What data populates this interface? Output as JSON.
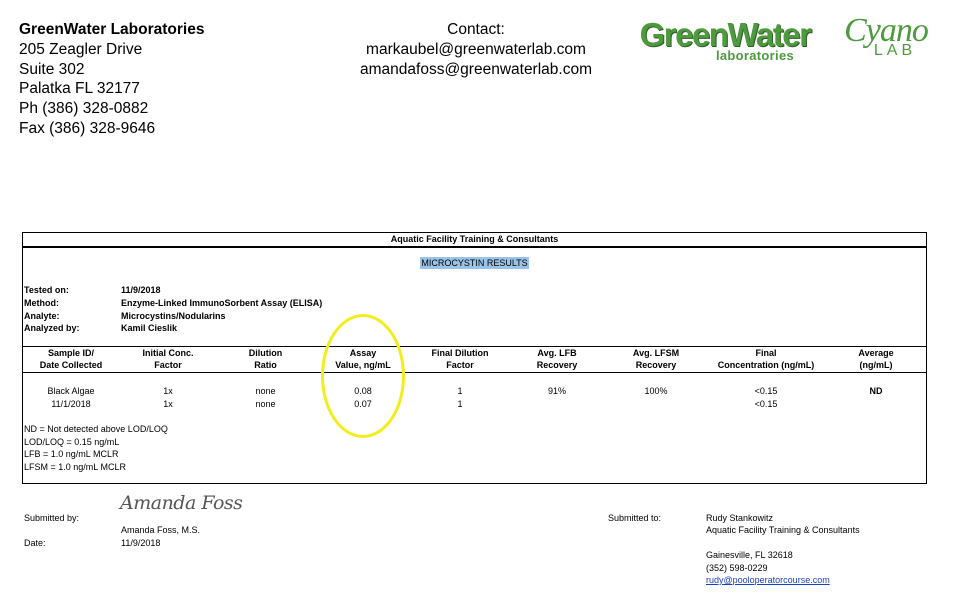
{
  "lab": {
    "name": "GreenWater Laboratories",
    "address_lines": [
      "205 Zeagler Drive",
      "Suite 302",
      "Palatka FL 32177",
      "Ph (386) 328-0882",
      "Fax (386) 328-9646"
    ]
  },
  "contact": {
    "label": "Contact:",
    "emails": [
      "markaubel@greenwaterlab.com",
      "amandafoss@greenwaterlab.com"
    ]
  },
  "logos": {
    "greenwater_main": "GreenWater",
    "greenwater_sub": "laboratories",
    "cyano_main": "Cyano",
    "cyano_sub": "LAB",
    "brand_color": "#4d9a3f"
  },
  "report": {
    "client": "Aquatic Facility Training & Consultants",
    "title": "MICROCYSTIN RESULTS",
    "info": [
      {
        "key": "Tested on:",
        "value": "11/9/2018"
      },
      {
        "key": "Method:",
        "value": "Enzyme-Linked ImmunoSorbent Assay (ELISA)"
      },
      {
        "key": "Analyte:",
        "value": "Microcystins/Nodularins"
      },
      {
        "key": "Analyzed by:",
        "value": "Kamil Cieslik"
      }
    ],
    "columns": [
      [
        "Sample ID/",
        "Date Collected"
      ],
      [
        "Initial Conc.",
        "Factor"
      ],
      [
        "Dilution",
        "Ratio"
      ],
      [
        "Assay",
        "Value, ng/mL"
      ],
      [
        "Final Dilution",
        "Factor"
      ],
      [
        "Avg. LFB",
        "Recovery"
      ],
      [
        "Avg. LFSM",
        "Recovery"
      ],
      [
        "Final",
        "Concentration (ng/mL)"
      ],
      [
        "Average",
        "(ng/mL)"
      ]
    ],
    "rows": [
      [
        "Black Algae",
        "1x",
        "none",
        "0.08",
        "1",
        "91%",
        "100%",
        "<0.15",
        "ND"
      ],
      [
        "11/1/2018",
        "1x",
        "none",
        "0.07",
        "1",
        "",
        "",
        "<0.15",
        ""
      ]
    ],
    "notes": [
      "ND = Not detected above LOD/LOQ",
      "LOD/LOQ = 0.15 ng/mL",
      "LFB = 1.0 ng/mL MCLR",
      "LFSM = 1.0 ng/mL MCLR"
    ],
    "highlight_color": "#f2ee1a"
  },
  "submission": {
    "submitted_by_label": "Submitted by:",
    "signature": "Amanda Foss",
    "submitter": "Amanda Foss, M.S.",
    "date_label": "Date:",
    "date": "11/9/2018",
    "submitted_to_label": "Submitted to:",
    "recipient_lines": [
      "Rudy Stankowitz",
      "Aquatic Facility Training & Consultants"
    ],
    "recipient_partial": "…",
    "recipient_city": "Gainesville, FL 32618",
    "recipient_phone": "(352) 598-0229",
    "recipient_email": "rudy@pooloperatorcourse.com"
  }
}
